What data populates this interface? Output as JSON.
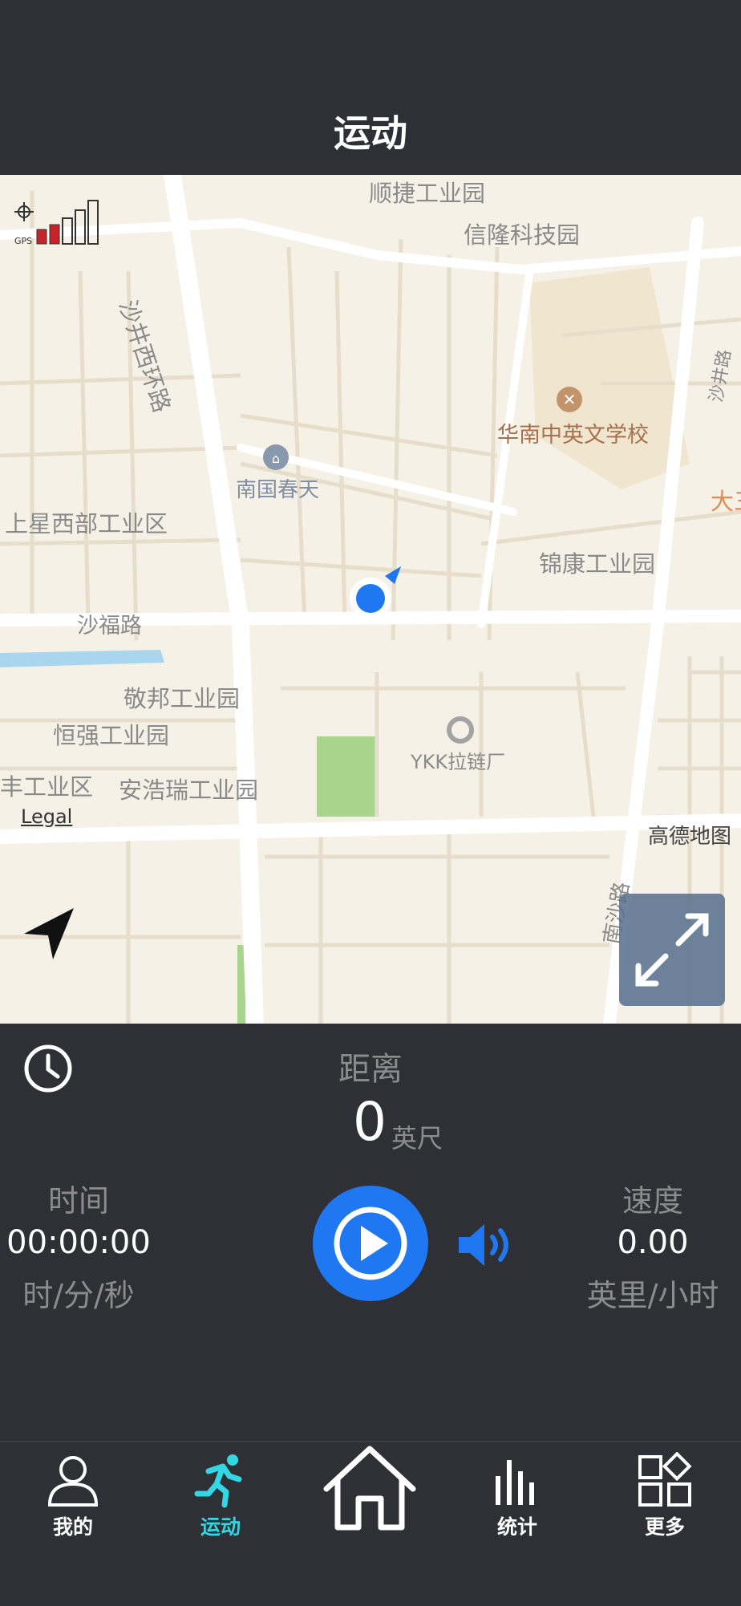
{
  "header": {
    "title": "运动"
  },
  "map": {
    "labels": {
      "shunjie": "顺捷工业园",
      "xinlong": "信隆科技园",
      "shajing_west": "沙井西环路",
      "huanan_school": "华南中英文学校",
      "shajing_road": "沙井路",
      "nanguo": "南国春天",
      "shangxing": "上星西部工业区",
      "dasan": "大三",
      "jinkang": "锦康工业园",
      "shafu": "沙福路",
      "jingbang": "敬邦工业园",
      "hengqiang": "恒强工业园",
      "feng": "丰工业区",
      "anhaorui": "安浩瑞工业园",
      "ykk": "YKK拉链厂",
      "nansha": "南沙路"
    },
    "legal": "Legal",
    "provider": "高德地图",
    "gps_text": "GPS"
  },
  "stats": {
    "distance_label": "距离",
    "distance_value": "0",
    "distance_unit": "英尺",
    "time_label": "时间",
    "time_value": "00:00:00",
    "time_unit": "时/分/秒",
    "speed_label": "速度",
    "speed_value": "0.00",
    "speed_unit": "英里/小时"
  },
  "tabs": [
    {
      "label": "我的",
      "icon": "person-icon"
    },
    {
      "label": "运动",
      "icon": "running-icon"
    },
    {
      "label": "",
      "icon": "home-icon"
    },
    {
      "label": "统计",
      "icon": "bar-chart-icon"
    },
    {
      "label": "更多",
      "icon": "grid-icon"
    }
  ],
  "colors": {
    "accent": "#1f77f2",
    "active_tab": "#33d6e3",
    "background": "#2f3035"
  }
}
